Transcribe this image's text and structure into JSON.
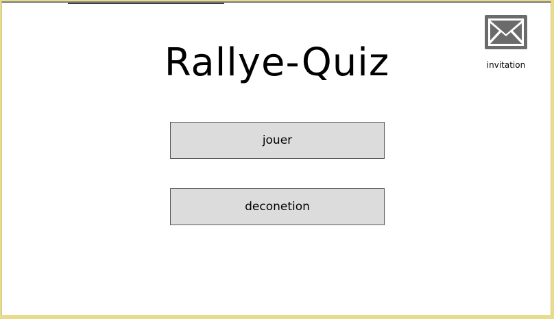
{
  "app": {
    "title": "Rallye-Quiz"
  },
  "menu": {
    "play_label": "jouer",
    "logout_label": "deconetion"
  },
  "invitation": {
    "label": "invitation",
    "icon": "envelope-icon"
  },
  "colors": {
    "background_border": "#e8dc8c",
    "button_fill": "#dcdcdc",
    "icon_fill": "#6b6b6b"
  }
}
